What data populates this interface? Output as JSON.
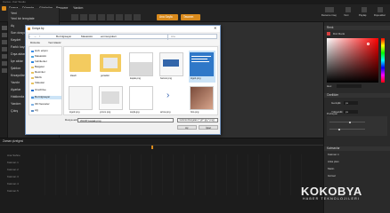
{
  "app": {
    "title": "Canva - Kaz Studio",
    "accent_color": "#d98a1c"
  },
  "topbar": {
    "menu_file": "Dosya",
    "menu_edit": "Düzenle",
    "menu_view": "Görünüm",
    "menu_window": "Pencere",
    "menu_help": "Yardım",
    "tab_1": "Ana Sayfa",
    "tab_2": "Tasarım",
    "right_buttons": [
      "Deneme imaj",
      "Yeni",
      "Paylaş",
      "Dışa aktar"
    ]
  },
  "leftmenu": {
    "items": [
      "Yeni",
      "Yeni bir template",
      "Aç",
      "Son dosyalar",
      "Kaydet",
      "Farklı kaydet",
      "Dışa aktar",
      "İçe aktar",
      "Şablon",
      "Kısayollar",
      "Yazdır",
      "Ayarlar",
      "Hakkında",
      "Yardım",
      "Çıkış"
    ]
  },
  "dialog": {
    "title": "Dosya Aç",
    "breadcrumb": [
      "Bu bilgisayar",
      "Masaüstü",
      "eminsoylulari"
    ],
    "search_placeholder": "Ara",
    "toolbar_organize": "Düzenle",
    "toolbar_newfolder": "Yeni klasör",
    "nav_items": [
      "Hızlı erişim",
      "Masaüstü",
      "İndirilenler",
      "Belgeler",
      "Resimler",
      "Müzik",
      "Videolar",
      "OneDrive",
      "Bu bilgisayar",
      "3D Nesneler",
      "Ağ"
    ],
    "files": [
      {
        "name": "klasör",
        "kind": "folder"
      },
      {
        "name": "gorseller",
        "kind": "folder"
      },
      {
        "name": "kapak.png",
        "kind": "image"
      },
      {
        "name": "banner.png",
        "kind": "image"
      },
      {
        "name": "logo1.png",
        "kind": "image"
      },
      {
        "name": "logo2.png",
        "kind": "image"
      },
      {
        "name": "yorum.png",
        "kind": "image"
      },
      {
        "name": "sayfa.jpg",
        "kind": "image"
      },
      {
        "name": "arrow.png",
        "kind": "image"
      },
      {
        "name": "foto.png",
        "kind": "image"
      },
      {
        "name": "ikon.png",
        "kind": "image"
      },
      {
        "name": "baslik.png",
        "kind": "image"
      }
    ],
    "filename_label": "Dosya adı:",
    "filename_value": "WANT-kapak.png",
    "filetype_value": "Görüntü Dosyaları (*.gif *.jpg *.png)",
    "open_label": "Aç",
    "cancel_label": "İptal"
  },
  "rightpanel": {
    "color_header": "Renk",
    "color_mode": "Düz Renk",
    "hex_label": "Hex",
    "selected_color": "#d64040",
    "props_header": "Özellikler",
    "width_label": "Genişlik",
    "height_label": "Yükseklik",
    "width_value": "px",
    "height_value": "px",
    "pos_label": "Pozisyon",
    "layers_header": "Katmanlar",
    "layer_items": [
      "Katman 1",
      "Arka plan",
      "Metin",
      "Görsel"
    ]
  },
  "timeline": {
    "header": "Zaman çizelgesi",
    "tracks": [
      "Ana Sahne",
      "Katman 1",
      "Katman 2",
      "Katman 3",
      "Katman 4",
      "Katman 5"
    ]
  },
  "watermark": {
    "brand": "KOKOBYA",
    "tagline": "HABER TEKNOLOJILERI"
  }
}
